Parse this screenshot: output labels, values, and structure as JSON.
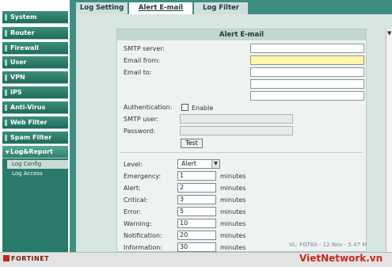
{
  "sidebar": {
    "items": [
      {
        "label": "System"
      },
      {
        "label": "Router"
      },
      {
        "label": "Firewall"
      },
      {
        "label": "User"
      },
      {
        "label": "VPN"
      },
      {
        "label": "IPS"
      },
      {
        "label": "Anti-Virus"
      },
      {
        "label": "Web Filter"
      },
      {
        "label": "Spam Filter"
      },
      {
        "label": "Log&Report"
      }
    ],
    "submenu": [
      {
        "label": "Log Config",
        "selected": true
      },
      {
        "label": "Log Access",
        "selected": false
      }
    ],
    "active_section": "Log&Report"
  },
  "tabs": [
    {
      "label": "Log Setting",
      "active": false
    },
    {
      "label": "Alert E-mail",
      "active": true
    },
    {
      "label": "Log Filter",
      "active": false
    }
  ],
  "panel": {
    "title": "Alert E-mail",
    "smtp_server_label": "SMTP server:",
    "smtp_server_value": "",
    "email_from_label": "Email from:",
    "email_from_value": "",
    "email_to_label": "Email to:",
    "email_to_values": [
      "",
      "",
      ""
    ],
    "authentication_label": "Authentication:",
    "enable_label": "Enable",
    "authentication_enabled": false,
    "smtp_user_label": "SMTP user:",
    "password_label": "Password:",
    "test_button": "Test",
    "level_label": "Level:",
    "level_value": "Alert",
    "thresholds": [
      {
        "label": "Emergency:",
        "value": "1",
        "unit": "minutes"
      },
      {
        "label": "Alert:",
        "value": "2",
        "unit": "minutes"
      },
      {
        "label": "Critical:",
        "value": "3",
        "unit": "minutes"
      },
      {
        "label": "Error:",
        "value": "5",
        "unit": "minutes"
      },
      {
        "label": "Warning:",
        "value": "10",
        "unit": "minutes"
      },
      {
        "label": "Notification:",
        "value": "20",
        "unit": "minutes"
      },
      {
        "label": "Information:",
        "value": "30",
        "unit": "minutes"
      }
    ]
  },
  "footer": {
    "logo": "FORTINET",
    "watermark": "VietNetwork.vn",
    "info": "VL: FGT60 - 12 Nov - 5.47 M"
  },
  "colors": {
    "sidebar_green": "#1e6b5c",
    "frame_green": "#3e8f80",
    "highlight_field": "#fff7a8",
    "watermark_red": "#d0261d"
  }
}
